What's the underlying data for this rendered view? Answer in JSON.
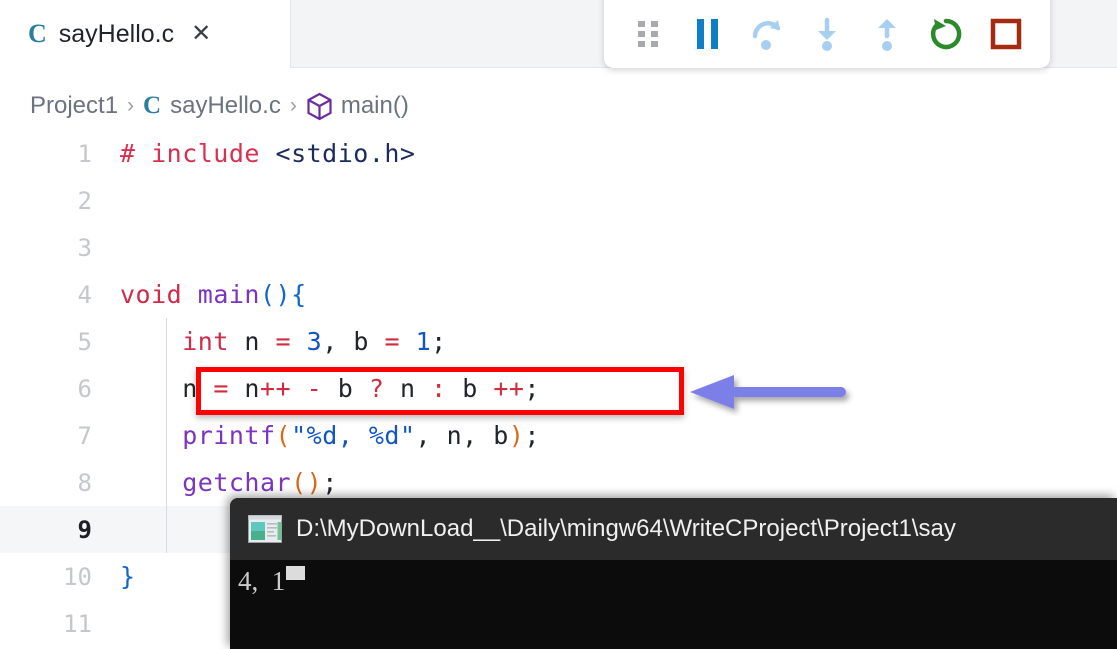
{
  "tab": {
    "language_icon": "c-file-icon",
    "filename": "sayHello.c",
    "close_glyph": "✕"
  },
  "debug_toolbar": {
    "buttons": [
      {
        "name": "drag-handle-icon",
        "label": ""
      },
      {
        "name": "pause-icon",
        "label": ""
      },
      {
        "name": "step-over-icon",
        "label": ""
      },
      {
        "name": "step-into-icon",
        "label": ""
      },
      {
        "name": "step-out-icon",
        "label": ""
      },
      {
        "name": "restart-icon",
        "label": ""
      },
      {
        "name": "stop-icon",
        "label": ""
      }
    ],
    "colors": {
      "pause": "#0f7ec4",
      "step": "#a9cff0",
      "restart": "#2b8a2b",
      "stop": "#a32b12",
      "handle": "#a7a9ad"
    }
  },
  "breadcrumb": {
    "project": "Project1",
    "file": "sayHello.c",
    "symbol": "main()",
    "separator": "›"
  },
  "editor": {
    "active_line": 9,
    "lines": [
      {
        "num": "1",
        "tokens": [
          {
            "t": "# include ",
            "c": "t-pp"
          },
          {
            "t": "<stdio.h>",
            "c": "t-inc"
          }
        ]
      },
      {
        "num": "2",
        "tokens": []
      },
      {
        "num": "3",
        "tokens": []
      },
      {
        "num": "4",
        "tokens": [
          {
            "t": "void ",
            "c": "t-kw"
          },
          {
            "t": "main",
            "c": "t-fn"
          },
          {
            "t": "(){",
            "c": "t-par"
          }
        ]
      },
      {
        "num": "5",
        "tokens": [
          {
            "t": "    ",
            "c": "t-pl"
          },
          {
            "t": "int",
            "c": "t-kw"
          },
          {
            "t": " n ",
            "c": "t-pl"
          },
          {
            "t": "=",
            "c": "t-op"
          },
          {
            "t": " ",
            "c": "t-pl"
          },
          {
            "t": "3",
            "c": "t-num"
          },
          {
            "t": ", b ",
            "c": "t-pl"
          },
          {
            "t": "=",
            "c": "t-op"
          },
          {
            "t": " ",
            "c": "t-pl"
          },
          {
            "t": "1",
            "c": "t-num"
          },
          {
            "t": ";",
            "c": "t-pl"
          }
        ]
      },
      {
        "num": "6",
        "tokens": [
          {
            "t": "    n ",
            "c": "t-pl"
          },
          {
            "t": "=",
            "c": "t-op"
          },
          {
            "t": " n",
            "c": "t-pl"
          },
          {
            "t": "++",
            "c": "t-op"
          },
          {
            "t": " ",
            "c": "t-pl"
          },
          {
            "t": "-",
            "c": "t-op"
          },
          {
            "t": " b ",
            "c": "t-pl"
          },
          {
            "t": "?",
            "c": "t-op"
          },
          {
            "t": " n ",
            "c": "t-pl"
          },
          {
            "t": ":",
            "c": "t-op"
          },
          {
            "t": " b ",
            "c": "t-pl"
          },
          {
            "t": "++",
            "c": "t-op"
          },
          {
            "t": ";",
            "c": "t-pl"
          }
        ]
      },
      {
        "num": "7",
        "tokens": [
          {
            "t": "    ",
            "c": "t-pl"
          },
          {
            "t": "printf",
            "c": "t-fn"
          },
          {
            "t": "(",
            "c": "t-paro"
          },
          {
            "t": "\"%d, %d\"",
            "c": "t-str"
          },
          {
            "t": ", n, b",
            "c": "t-pl"
          },
          {
            "t": ")",
            "c": "t-paro"
          },
          {
            "t": ";",
            "c": "t-pl"
          }
        ]
      },
      {
        "num": "8",
        "tokens": [
          {
            "t": "    ",
            "c": "t-pl"
          },
          {
            "t": "getchar",
            "c": "t-fn"
          },
          {
            "t": "(",
            "c": "t-paro"
          },
          {
            "t": ")",
            "c": "t-paro"
          },
          {
            "t": ";",
            "c": "t-pl"
          }
        ]
      },
      {
        "num": "9",
        "tokens": []
      },
      {
        "num": "10",
        "tokens": [
          {
            "t": "}",
            "c": "t-brace"
          }
        ]
      },
      {
        "num": "11",
        "tokens": []
      }
    ]
  },
  "annotation": {
    "highlight_box_color": "#fb0303",
    "arrow_color": "#7b7fe8",
    "highlighted_code": "n = n++ - b ? n : b ++;"
  },
  "console": {
    "icon": "console-window-icon",
    "title": "D:\\MyDownLoad__\\Daily\\mingw64\\WriteCProject\\Project1\\say",
    "output": "4,  1",
    "cursor": "block-cursor"
  }
}
